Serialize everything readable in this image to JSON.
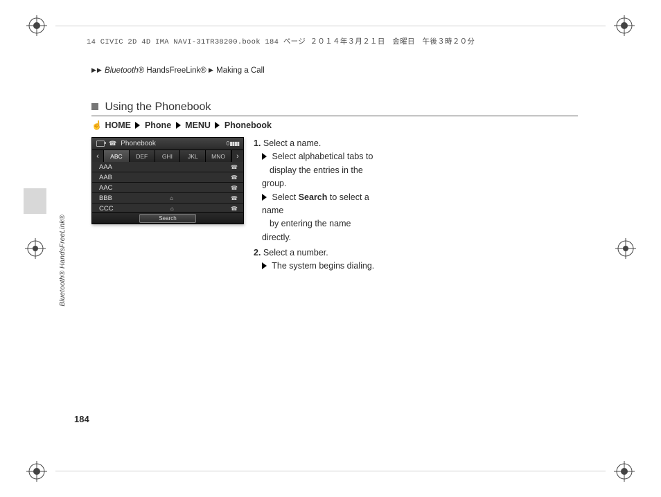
{
  "meta": {
    "bookline": "14 CIVIC 2D 4D IMA NAVI-31TR38200.book  184 ページ   ２０１４年３月２１日　金曜日　午後３時２０分"
  },
  "breadcrumb": {
    "segment1": "Bluetooth",
    "segment1_suffix": "® HandsFreeLink®",
    "segment2": "Making a Call"
  },
  "side_label": "Bluetooth® HandsFreeLink®",
  "section_title": "Using the Phonebook",
  "navpath": {
    "hand": "☝",
    "items": [
      "HOME",
      "Phone",
      "MENU",
      "Phonebook"
    ]
  },
  "shot": {
    "header_title": "Phonebook",
    "signal": "0 ▮▮▮▮",
    "tabs": [
      "ABC",
      "DEF",
      "GHI",
      "JKL",
      "MNO"
    ],
    "active_tab": 0,
    "entries": [
      {
        "name": "AAA",
        "icons": [
          "☎"
        ]
      },
      {
        "name": "AAB",
        "icons": [
          "☎"
        ]
      },
      {
        "name": "AAC",
        "icons": [
          "☎"
        ]
      },
      {
        "name": "BBB",
        "icons": [
          "⌂",
          "☎"
        ]
      },
      {
        "name": "CCC",
        "icons": [
          "⌂",
          "☎"
        ]
      }
    ],
    "search_label": "Search"
  },
  "steps": {
    "one_num": "1.",
    "one_text": "Select a name.",
    "one_sub_a1": "Select alphabetical tabs to",
    "one_sub_a2": "display the entries in the group.",
    "one_sub_b_pre": "Select ",
    "one_sub_b_bold": "Search",
    "one_sub_b_post": " to select a name",
    "one_sub_b2": "by entering the name directly.",
    "two_num": "2.",
    "two_text": "Select a number.",
    "two_sub": "The system begins dialing."
  },
  "page_number": "184"
}
